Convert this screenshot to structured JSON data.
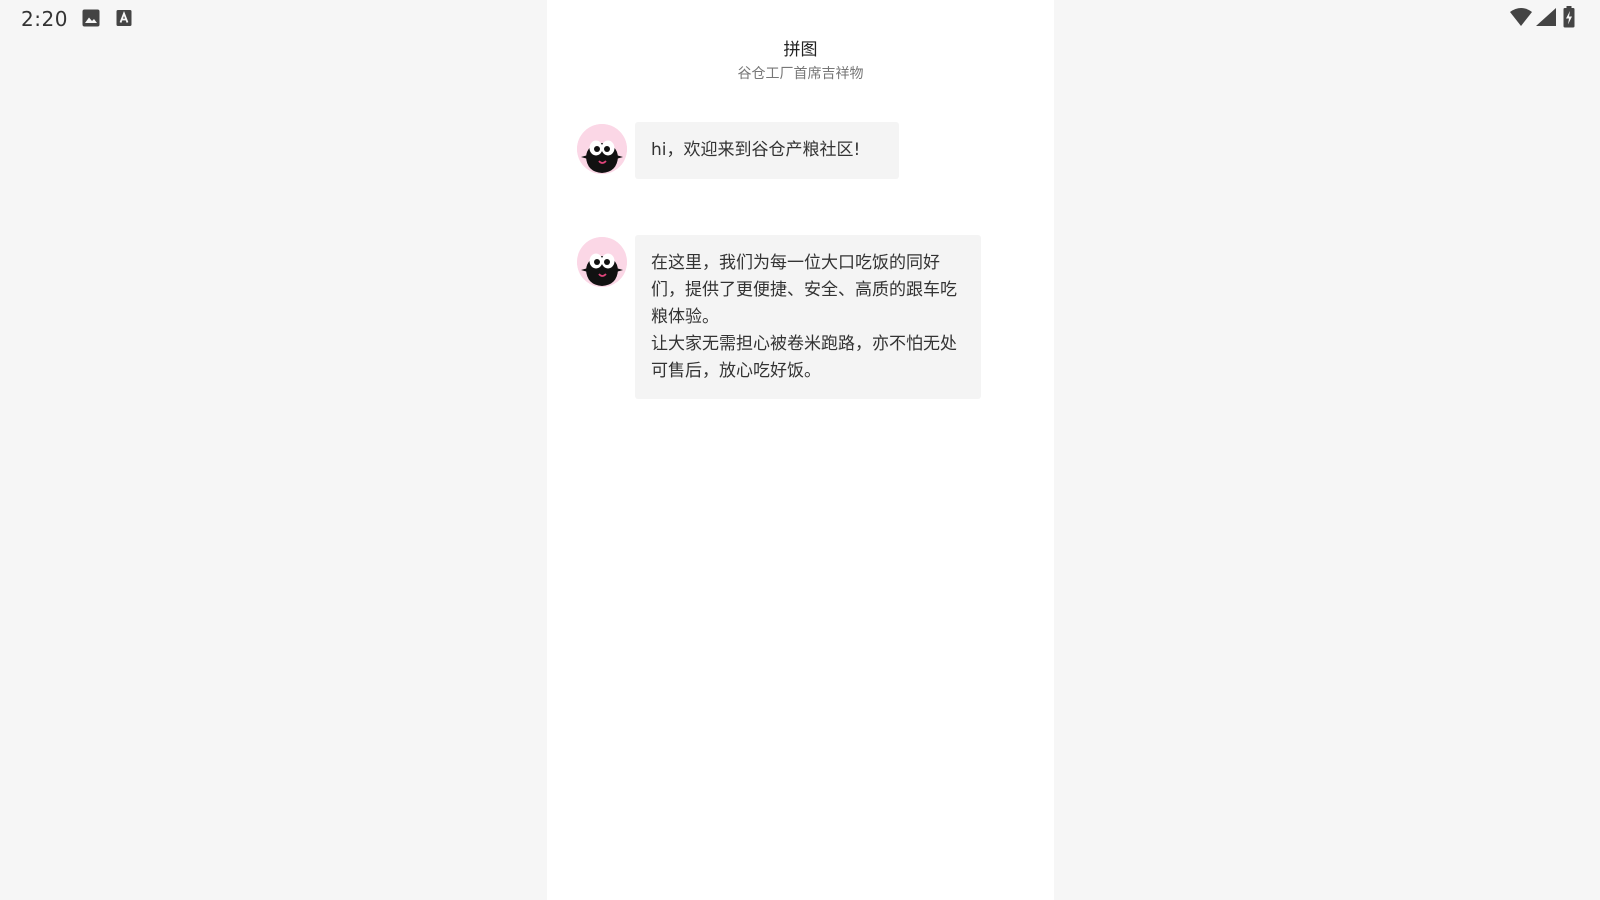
{
  "status_bar": {
    "time": "2:20",
    "left_icons": [
      "image-icon",
      "a-box-icon"
    ],
    "right_icons": [
      "wifi-icon",
      "cell-signal-icon",
      "battery-charging-icon"
    ]
  },
  "header": {
    "title": "拼图",
    "subtitle": "谷仓工厂首席吉祥物"
  },
  "messages": [
    {
      "avatar": "mascot-avatar",
      "text": "hi，欢迎来到谷仓产粮社区!"
    },
    {
      "avatar": "mascot-avatar",
      "text": "在这里，我们为每一位大口吃饭的同好们，提供了更便捷、安全、高质的跟车吃粮体验。\n让大家无需担心被卷米跑路，亦不怕无处可售后，放心吃好饭。"
    }
  ],
  "colors": {
    "background": "#f6f6f6",
    "panel": "#ffffff",
    "bubble": "#f4f4f4",
    "avatar_bg": "#fbd7e6"
  }
}
